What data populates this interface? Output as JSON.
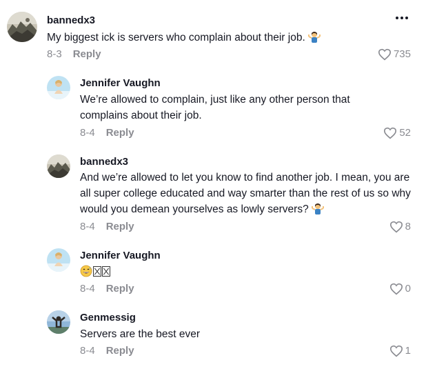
{
  "comments": [
    {
      "username": "bannedx3",
      "text": "My biggest ick is servers who complain about their job.",
      "emoji": "woman-shrugging",
      "date": "8-3",
      "reply_label": "Reply",
      "likes": "735",
      "avatar": "rock-landscape-avatar"
    },
    {
      "username": "Jennifer Vaughn",
      "text": "We’re allowed to complain, just like any other person that complains about their job.",
      "date": "8-4",
      "reply_label": "Reply",
      "likes": "52",
      "avatar": "beach-person-avatar"
    },
    {
      "username": "bannedx3",
      "text": "And we’re allowed to let you know to find another job. I mean, you are all super college educated and way smarter than the rest of us so why would you demean yourselves as lowly servers?",
      "emoji": "woman-shrugging",
      "date": "8-4",
      "reply_label": "Reply",
      "likes": "8",
      "avatar": "rock-landscape-avatar"
    },
    {
      "username": "Jennifer Vaughn",
      "text": "",
      "emoji": "grinning-sweat-face",
      "date": "8-4",
      "reply_label": "Reply",
      "likes": "0",
      "avatar": "beach-person-avatar"
    },
    {
      "username": "Genmessig",
      "text": "Servers are the best ever",
      "date": "8-4",
      "reply_label": "Reply",
      "likes": "1",
      "avatar": "sky-person-avatar"
    }
  ],
  "colors": {
    "primary_text": "#161823",
    "secondary_text": "#8a8b91"
  }
}
